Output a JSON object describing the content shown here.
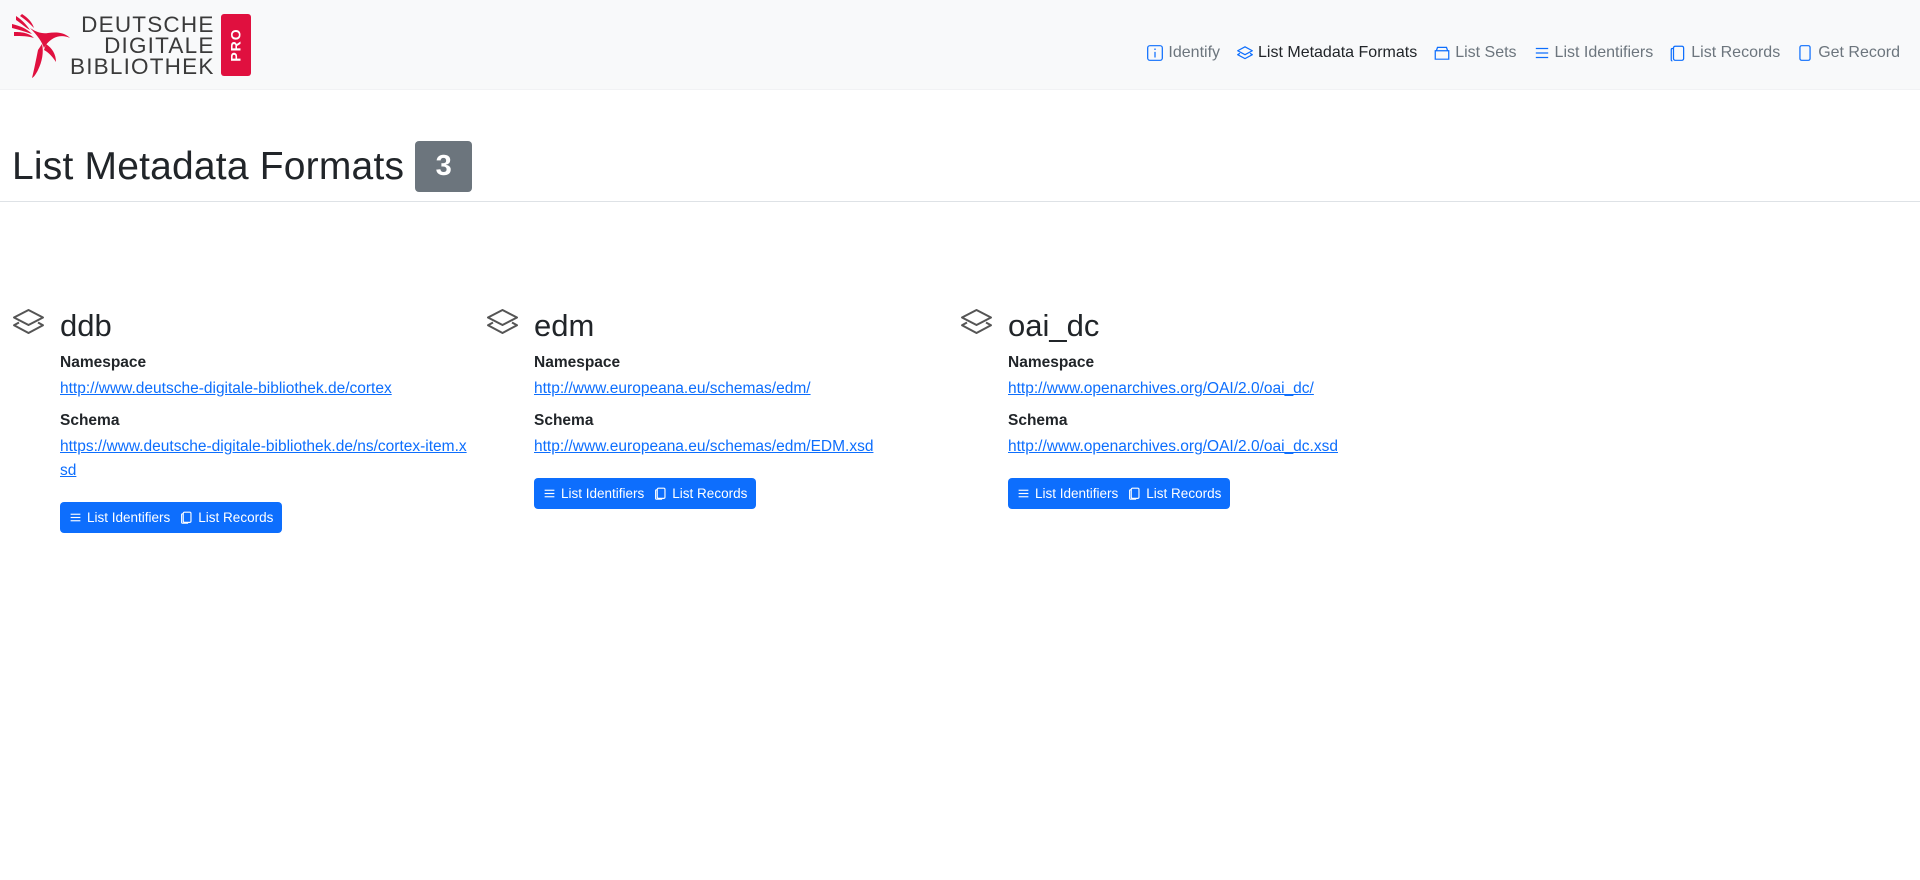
{
  "brand": {
    "lines": [
      "DEUTSCHE",
      "DIGITALE",
      "BIBLIOTHEK"
    ],
    "badge": "PRO"
  },
  "nav": [
    {
      "label": "Identify",
      "icon": "info-icon",
      "active": false
    },
    {
      "label": "List Metadata Formats",
      "icon": "layers-icon",
      "active": true
    },
    {
      "label": "List Sets",
      "icon": "archive-icon",
      "active": false
    },
    {
      "label": "List Identifiers",
      "icon": "list-icon",
      "active": false
    },
    {
      "label": "List Records",
      "icon": "copy-icon",
      "active": false
    },
    {
      "label": "Get Record",
      "icon": "file-icon",
      "active": false
    }
  ],
  "page": {
    "title": "List Metadata Formats",
    "count": "3"
  },
  "labels": {
    "namespace": "Namespace",
    "schema": "Schema",
    "list_identifiers": "List Identifiers",
    "list_records": "List Records"
  },
  "formats": [
    {
      "name": "ddb",
      "namespace": "http://www.deutsche-digitale-bibliothek.de/cortex",
      "schema": "https://www.deutsche-digitale-bibliothek.de/ns/cortex-item.xsd"
    },
    {
      "name": "edm",
      "namespace": "http://www.europeana.eu/schemas/edm/",
      "schema": "http://www.europeana.eu/schemas/edm/EDM.xsd"
    },
    {
      "name": "oai_dc",
      "namespace": "http://www.openarchives.org/OAI/2.0/oai_dc/",
      "schema": "http://www.openarchives.org/OAI/2.0/oai_dc.xsd"
    }
  ],
  "colors": {
    "brand_red": "#e0103f",
    "primary": "#0d6efd",
    "badge_gray": "#6c757d",
    "navbar_bg": "#f8f9fa"
  }
}
